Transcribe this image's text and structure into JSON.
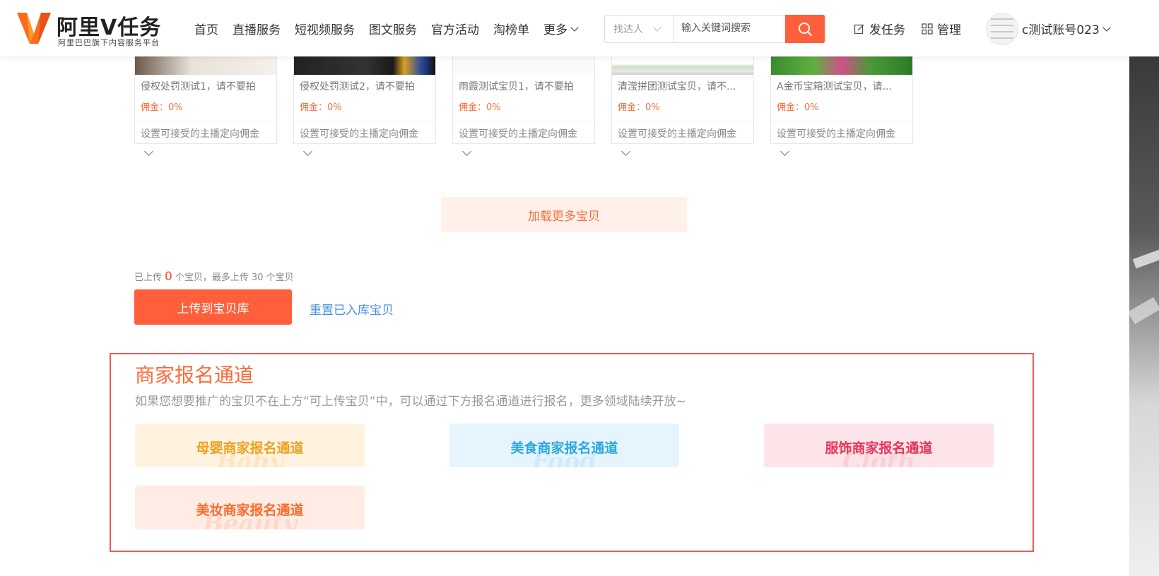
{
  "colors": {
    "brand": "#ff5f3a",
    "link": "#4a90e2",
    "highlight_border": "#f05a5a"
  },
  "header": {
    "logo_title": "阿里V任务",
    "logo_subtitle": "阿里巴巴旗下内容服务平台",
    "nav": [
      "首页",
      "直播服务",
      "短视频服务",
      "图文服务",
      "官方活动",
      "淘榜单"
    ],
    "more_label": "更多",
    "search": {
      "type_selected": "找达人",
      "placeholder": "输入关键词搜索",
      "icon": "search-icon"
    },
    "publish_task": "发任务",
    "manage": "管理",
    "username": "c测试账号023"
  },
  "products": [
    {
      "title": "侵权处罚测试1，请不要拍",
      "commission": "佣金：0%",
      "setting": "设置可接受的主播定向佣金"
    },
    {
      "title": "侵权处罚测试2，请不要拍",
      "commission": "佣金：0%",
      "setting": "设置可接受的主播定向佣金"
    },
    {
      "title": "雨霞测试宝贝1，请不要拍",
      "commission": "佣金：0%",
      "setting": "设置可接受的主播定向佣金"
    },
    {
      "title": "清滢拼团测试宝贝，请不...",
      "commission": "佣金：0%",
      "setting": "设置可接受的主播定向佣金"
    },
    {
      "title": "A金币宝箱测试宝贝，请...",
      "commission": "佣金：0%",
      "setting": "设置可接受的主播定向佣金"
    }
  ],
  "load_more": "加载更多宝贝",
  "upload": {
    "prefix": "已上传",
    "count": "0",
    "suffix": "个宝贝，最多上传 30 个宝贝",
    "button": "上传到宝贝库",
    "reset": "重置已入库宝贝"
  },
  "merchant": {
    "title": "商家报名通道",
    "description": "如果您想要推广的宝贝不在上方“可上传宝贝”中，可以通过下方报名通道进行报名，更多领域陆续开放~",
    "channels": [
      {
        "label": "母婴商家报名通道",
        "bg_text": "Baby",
        "bg": "#fff3e0",
        "color": "#f0a020"
      },
      {
        "label": "美食商家报名通道",
        "bg_text": "Food",
        "bg": "#e6f5fd",
        "color": "#2aa8e0"
      },
      {
        "label": "服饰商家报名通道",
        "bg_text": "Cloth",
        "bg": "#fde4e8",
        "color": "#e8335a"
      },
      {
        "label": "美妆商家报名通道",
        "bg_text": "Beauty",
        "bg": "#ffece4",
        "color": "#ff6a2a"
      }
    ]
  }
}
